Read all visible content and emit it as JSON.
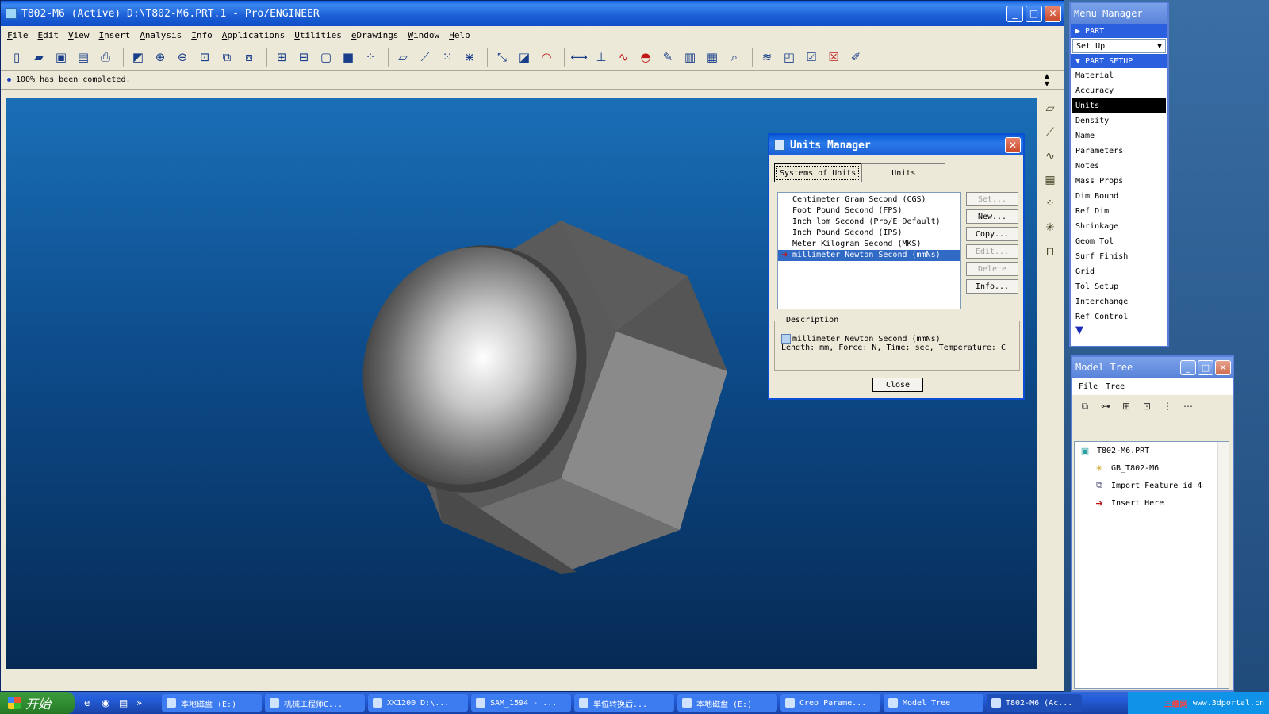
{
  "main_window": {
    "title": "T802-M6 (Active)  D:\\T802-M6.PRT.1 - Pro/ENGINEER",
    "controls": [
      "_",
      "□",
      "✕"
    ]
  },
  "menubar": [
    "File",
    "Edit",
    "View",
    "Insert",
    "Analysis",
    "Info",
    "Applications",
    "Utilities",
    "eDrawings",
    "Window",
    "Help"
  ],
  "toolbar_icons": [
    "new-icon",
    "open-icon",
    "save-icon",
    "save-copy-icon",
    "print-icon",
    "repaint-icon",
    "zoom-in-icon",
    "zoom-out-icon",
    "refit-icon",
    "orient-icon",
    "saved-views-icon",
    "datum-planes-icon",
    "datum-axes-icon",
    "datum-points-icon",
    "csys-icon",
    "shading-icon",
    "sketch-icon",
    "plane-tool-icon",
    "axis-tool-icon",
    "point-tool-icon",
    "csys-tool-icon",
    "select-icon",
    "select-box-icon",
    "rotate-icon",
    "measure-icon",
    "analysis-icon",
    "curve-icon",
    "surface-icon",
    "pencil-icon",
    "table-icon",
    "relations-icon",
    "info-icon",
    "layers-icon",
    "window-icon",
    "windows-icon",
    "close-window-icon",
    "edit-icon"
  ],
  "message": "100% has been completed.",
  "units_manager": {
    "title": "Units Manager",
    "tabs": [
      "Systems of Units",
      "Units"
    ],
    "systems": [
      "Centimeter Gram Second (CGS)",
      "Foot Pound Second (FPS)",
      "Inch lbm Second (Pro/E Default)",
      "Inch Pound Second (IPS)",
      "Meter Kilogram Second (MKS)",
      "millimeter Newton Second (mmNs)"
    ],
    "selected_index": 5,
    "buttons": {
      "set": "Set...",
      "new": "New...",
      "copy": "Copy...",
      "edit": "Edit...",
      "delete": "Delete",
      "info": "Info..."
    },
    "description_label": "Description",
    "description_name": "millimeter Newton Second (mmNs)",
    "description_detail": "Length: mm, Force: N, Time: sec, Temperature: C",
    "close_label": "Close"
  },
  "menu_manager": {
    "title": "Menu Manager",
    "part_header": "PART",
    "setup_value": "Set Up",
    "part_setup_header": "PART SETUP",
    "items": [
      "Material",
      "Accuracy",
      "Units",
      "Density",
      "Name",
      "Parameters",
      "Notes",
      "Mass Props",
      "Dim Bound",
      "Ref Dim",
      "Shrinkage",
      "Geom Tol",
      "Surf Finish",
      "Grid",
      "Tol Setup",
      "Interchange",
      "Ref Control"
    ],
    "selected_item": "Units"
  },
  "model_tree": {
    "title": "Model Tree",
    "menu": [
      "File",
      "Tree"
    ],
    "nodes": [
      {
        "label": "T802-M6.PRT",
        "icon": "part-icon"
      },
      {
        "label": "GB_T802-M6",
        "icon": "csys-icon"
      },
      {
        "label": "Import Feature id 4",
        "icon": "import-feature-icon"
      },
      {
        "label": "Insert Here",
        "icon": "insert-here-icon"
      }
    ]
  },
  "taskbar": {
    "start_label": "开始",
    "tasks": [
      "本地磁盘 (E:)",
      "机械工程师C...",
      "XK1200  D:\\...",
      "SAM_1594 - ...",
      "单位转换后...",
      "本地磁盘 (E:)",
      "Creo Parame...",
      "Model Tree",
      "T802-M6 (Ac..."
    ],
    "tray_brand": "三维网",
    "tray_url": "www.3dportal.cn"
  },
  "colors": {
    "xp_blue": "#0a5bd8",
    "selection": "#316ac5",
    "viewport_top": "#1a6fb7",
    "viewport_bottom": "#062a55"
  }
}
